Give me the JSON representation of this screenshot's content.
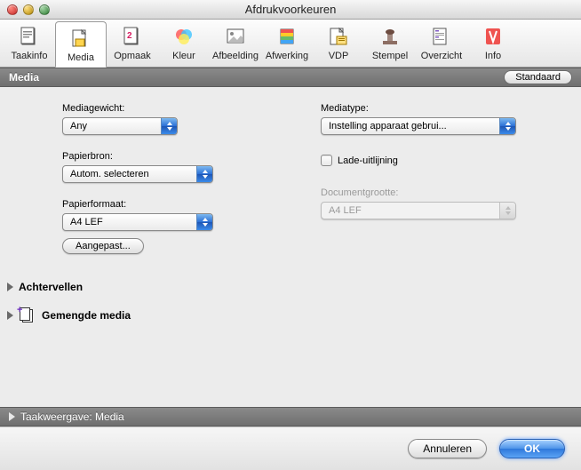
{
  "window": {
    "title": "Afdrukvoorkeuren"
  },
  "toolbar": {
    "items": [
      {
        "label": "Taakinfo"
      },
      {
        "label": "Media"
      },
      {
        "label": "Opmaak"
      },
      {
        "label": "Kleur"
      },
      {
        "label": "Afbeelding"
      },
      {
        "label": "Afwerking"
      },
      {
        "label": "VDP"
      },
      {
        "label": "Stempel"
      },
      {
        "label": "Overzicht"
      },
      {
        "label": "Info"
      }
    ],
    "selected_index": 1
  },
  "section": {
    "title": "Media",
    "default_button": "Standaard"
  },
  "media": {
    "weight_label": "Mediagewicht:",
    "weight_value": "Any",
    "source_label": "Papierbron:",
    "source_value": "Autom. selecteren",
    "format_label": "Papierformaat:",
    "format_value": "A4 LEF",
    "custom_button": "Aangepast...",
    "type_label": "Mediatype:",
    "type_value": "Instelling apparaat gebrui...",
    "tray_align_label": "Lade-uitlijning",
    "tray_align_checked": false,
    "docsize_label": "Documentgrootte:",
    "docsize_value": "A4 LEF"
  },
  "disclosures": {
    "back_covers": "Achtervellen",
    "mixed_media": "Gemengde media"
  },
  "preview_bar": {
    "label": "Taakweergave: Media"
  },
  "footer": {
    "cancel": "Annuleren",
    "ok": "OK"
  }
}
